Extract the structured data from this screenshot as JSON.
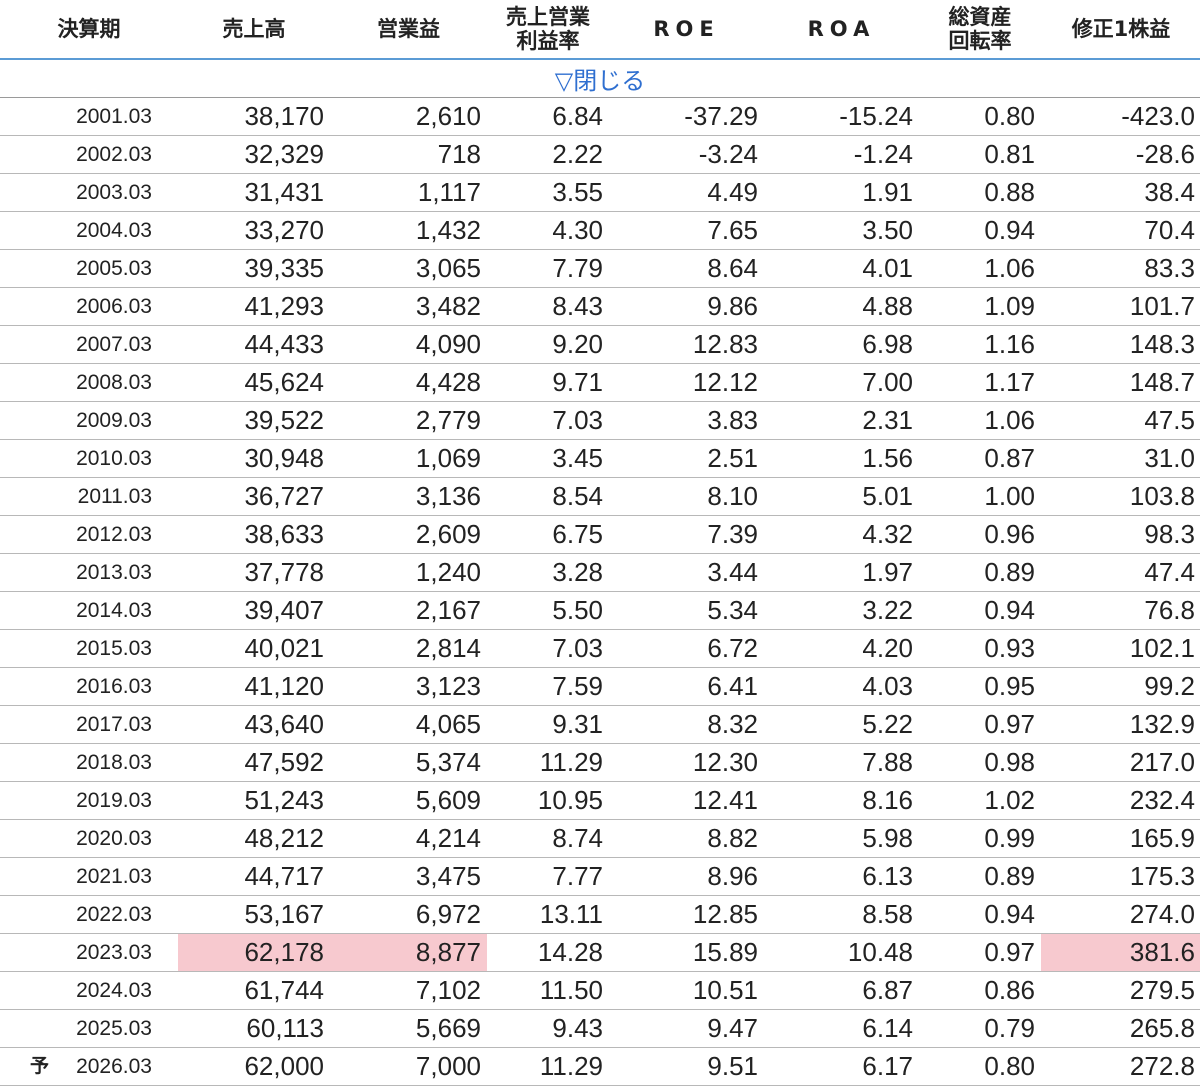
{
  "header": [
    "決算期",
    "売上高",
    "営業益",
    "売上営業\n利益率",
    "ROE",
    "ROA",
    "総資産\n回転率",
    "修正1株益"
  ],
  "toggle_label": "▽閉じる",
  "highlight_color": "#f7c9cf",
  "link_color": "#2f6fd0",
  "rows": [
    {
      "period": "2001.03",
      "cells": [
        "38,170",
        "2,610",
        "6.84",
        "-37.29",
        "-15.24",
        "0.80",
        "-423.0"
      ]
    },
    {
      "period": "2002.03",
      "cells": [
        "32,329",
        "718",
        "2.22",
        "-3.24",
        "-1.24",
        "0.81",
        "-28.6"
      ]
    },
    {
      "period": "2003.03",
      "cells": [
        "31,431",
        "1,117",
        "3.55",
        "4.49",
        "1.91",
        "0.88",
        "38.4"
      ]
    },
    {
      "period": "2004.03",
      "cells": [
        "33,270",
        "1,432",
        "4.30",
        "7.65",
        "3.50",
        "0.94",
        "70.4"
      ]
    },
    {
      "period": "2005.03",
      "cells": [
        "39,335",
        "3,065",
        "7.79",
        "8.64",
        "4.01",
        "1.06",
        "83.3"
      ]
    },
    {
      "period": "2006.03",
      "cells": [
        "41,293",
        "3,482",
        "8.43",
        "9.86",
        "4.88",
        "1.09",
        "101.7"
      ]
    },
    {
      "period": "2007.03",
      "cells": [
        "44,433",
        "4,090",
        "9.20",
        "12.83",
        "6.98",
        "1.16",
        "148.3"
      ]
    },
    {
      "period": "2008.03",
      "cells": [
        "45,624",
        "4,428",
        "9.71",
        "12.12",
        "7.00",
        "1.17",
        "148.7"
      ]
    },
    {
      "period": "2009.03",
      "cells": [
        "39,522",
        "2,779",
        "7.03",
        "3.83",
        "2.31",
        "1.06",
        "47.5"
      ]
    },
    {
      "period": "2010.03",
      "cells": [
        "30,948",
        "1,069",
        "3.45",
        "2.51",
        "1.56",
        "0.87",
        "31.0"
      ]
    },
    {
      "period": "2011.03",
      "cells": [
        "36,727",
        "3,136",
        "8.54",
        "8.10",
        "5.01",
        "1.00",
        "103.8"
      ]
    },
    {
      "period": "2012.03",
      "cells": [
        "38,633",
        "2,609",
        "6.75",
        "7.39",
        "4.32",
        "0.96",
        "98.3"
      ]
    },
    {
      "period": "2013.03",
      "cells": [
        "37,778",
        "1,240",
        "3.28",
        "3.44",
        "1.97",
        "0.89",
        "47.4"
      ]
    },
    {
      "period": "2014.03",
      "cells": [
        "39,407",
        "2,167",
        "5.50",
        "5.34",
        "3.22",
        "0.94",
        "76.8"
      ]
    },
    {
      "period": "2015.03",
      "cells": [
        "40,021",
        "2,814",
        "7.03",
        "6.72",
        "4.20",
        "0.93",
        "102.1"
      ]
    },
    {
      "period": "2016.03",
      "cells": [
        "41,120",
        "3,123",
        "7.59",
        "6.41",
        "4.03",
        "0.95",
        "99.2"
      ]
    },
    {
      "period": "2017.03",
      "cells": [
        "43,640",
        "4,065",
        "9.31",
        "8.32",
        "5.22",
        "0.97",
        "132.9"
      ]
    },
    {
      "period": "2018.03",
      "cells": [
        "47,592",
        "5,374",
        "11.29",
        "12.30",
        "7.88",
        "0.98",
        "217.0"
      ]
    },
    {
      "period": "2019.03",
      "cells": [
        "51,243",
        "5,609",
        "10.95",
        "12.41",
        "8.16",
        "1.02",
        "232.4"
      ]
    },
    {
      "period": "2020.03",
      "cells": [
        "48,212",
        "4,214",
        "8.74",
        "8.82",
        "5.98",
        "0.99",
        "165.9"
      ]
    },
    {
      "period": "2021.03",
      "cells": [
        "44,717",
        "3,475",
        "7.77",
        "8.96",
        "6.13",
        "0.89",
        "175.3"
      ]
    },
    {
      "period": "2022.03",
      "cells": [
        "53,167",
        "6,972",
        "13.11",
        "12.85",
        "8.58",
        "0.94",
        "274.0"
      ]
    },
    {
      "period": "2023.03",
      "cells": [
        "62,178",
        "8,877",
        "14.28",
        "15.89",
        "10.48",
        "0.97",
        "381.6"
      ],
      "highlight": [
        0,
        1,
        6
      ]
    },
    {
      "period": "2024.03",
      "cells": [
        "61,744",
        "7,102",
        "11.50",
        "10.51",
        "6.87",
        "0.86",
        "279.5"
      ]
    },
    {
      "period": "2025.03",
      "cells": [
        "60,113",
        "5,669",
        "9.43",
        "9.47",
        "6.14",
        "0.79",
        "265.8"
      ]
    },
    {
      "period": "2026.03",
      "cells": [
        "62,000",
        "7,000",
        "11.29",
        "9.51",
        "6.17",
        "0.80",
        "272.8"
      ],
      "mark": "予"
    }
  ]
}
